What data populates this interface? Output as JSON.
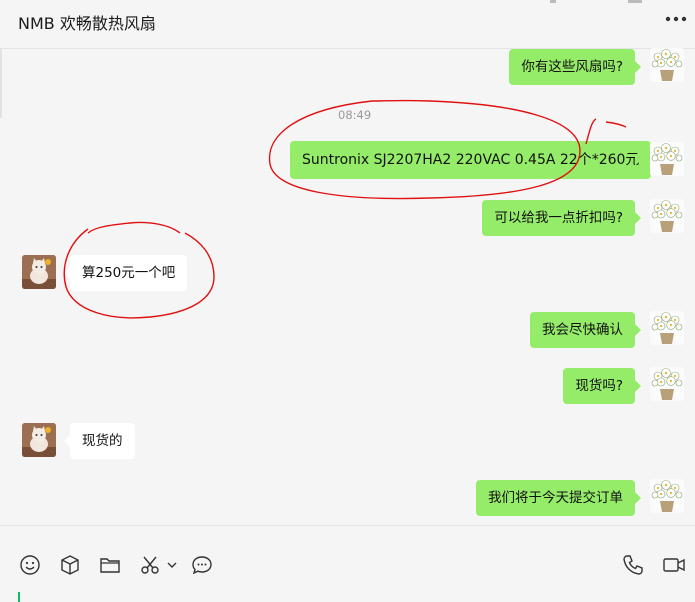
{
  "header": {
    "title": "NMB 欢畅散热风扇",
    "more_icon": "more-dots-icon"
  },
  "timestamp": "08:49",
  "messages": [
    {
      "from": "me",
      "text": "你有这些风扇吗?"
    },
    {
      "from": "me",
      "text": "Suntronix SJ2207HA2 220VAC 0.45A 22个*260元"
    },
    {
      "from": "me",
      "text": "可以给我一点折扣吗?"
    },
    {
      "from": "them",
      "text": "算250元一个吧"
    },
    {
      "from": "me",
      "text": "我会尽快确认"
    },
    {
      "from": "me",
      "text": "现货吗?"
    },
    {
      "from": "them",
      "text": "现货的"
    },
    {
      "from": "me",
      "text": "我们将于今天提交订单"
    }
  ],
  "colors": {
    "my_bubble": "#95ec69",
    "their_bubble": "#ffffff",
    "annotation_circle": "#e01010",
    "background": "#f5f5f5",
    "cursor": "#07c160"
  },
  "toolbar": {
    "left_tools": [
      "emoji-icon",
      "package-icon",
      "folder-icon",
      "scissors-icon",
      "chevron-down-icon",
      "chat-bubble-icon"
    ],
    "right_tools": [
      "phone-icon",
      "video-icon"
    ]
  }
}
